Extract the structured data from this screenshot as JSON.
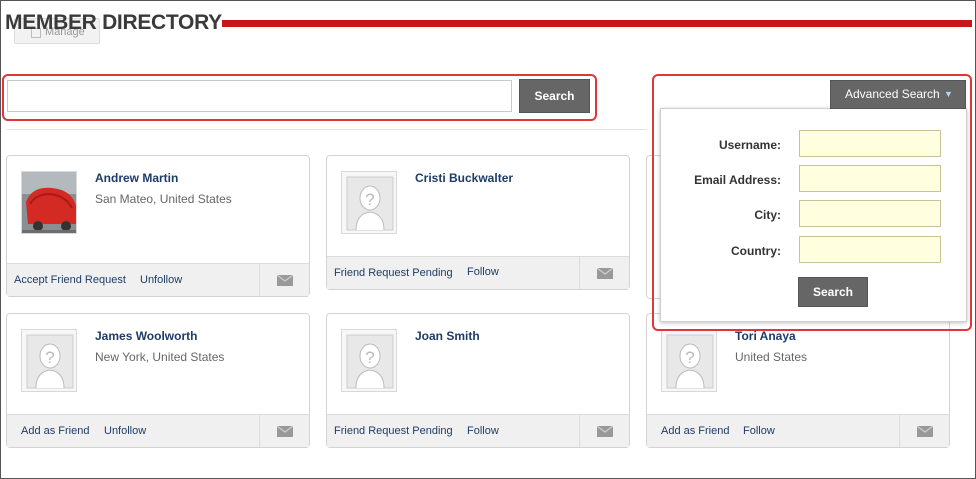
{
  "header": {
    "manage_label": "Manage",
    "title": "MEMBER DIRECTORY"
  },
  "search": {
    "value": "",
    "button_label": "Search"
  },
  "advanced_search": {
    "toggle_label": "Advanced Search",
    "fields": [
      {
        "label": "Username:",
        "value": ""
      },
      {
        "label": "Email Address:",
        "value": ""
      },
      {
        "label": "City:",
        "value": ""
      },
      {
        "label": "Country:",
        "value": ""
      }
    ],
    "button_label": "Search"
  },
  "members": [
    {
      "name": "Andrew Martin",
      "location": "San Mateo, United States",
      "action1": "Accept Friend Request",
      "action2": "Unfollow",
      "has_photo": true
    },
    {
      "name": "Cristi Buckwalter",
      "location": "",
      "action1": "Friend Request Pending",
      "action2": "Follow",
      "has_photo": false
    },
    {
      "name": "James Woolworth",
      "location": "New York, United States",
      "action1": "Add as Friend",
      "action2": "Unfollow",
      "has_photo": false
    },
    {
      "name": "Joan Smith",
      "location": "",
      "action1": "Friend Request Pending",
      "action2": "Follow",
      "has_photo": false
    },
    {
      "name": "Tori Anaya",
      "location": "United States",
      "action1": "Add as Friend",
      "action2": "Follow",
      "has_photo": false
    }
  ],
  "colors": {
    "accent_red": "#c8161d",
    "highlight": "#e0353a",
    "link": "#1d3c66",
    "button": "#666666",
    "field_bg": "#ffffe0"
  }
}
